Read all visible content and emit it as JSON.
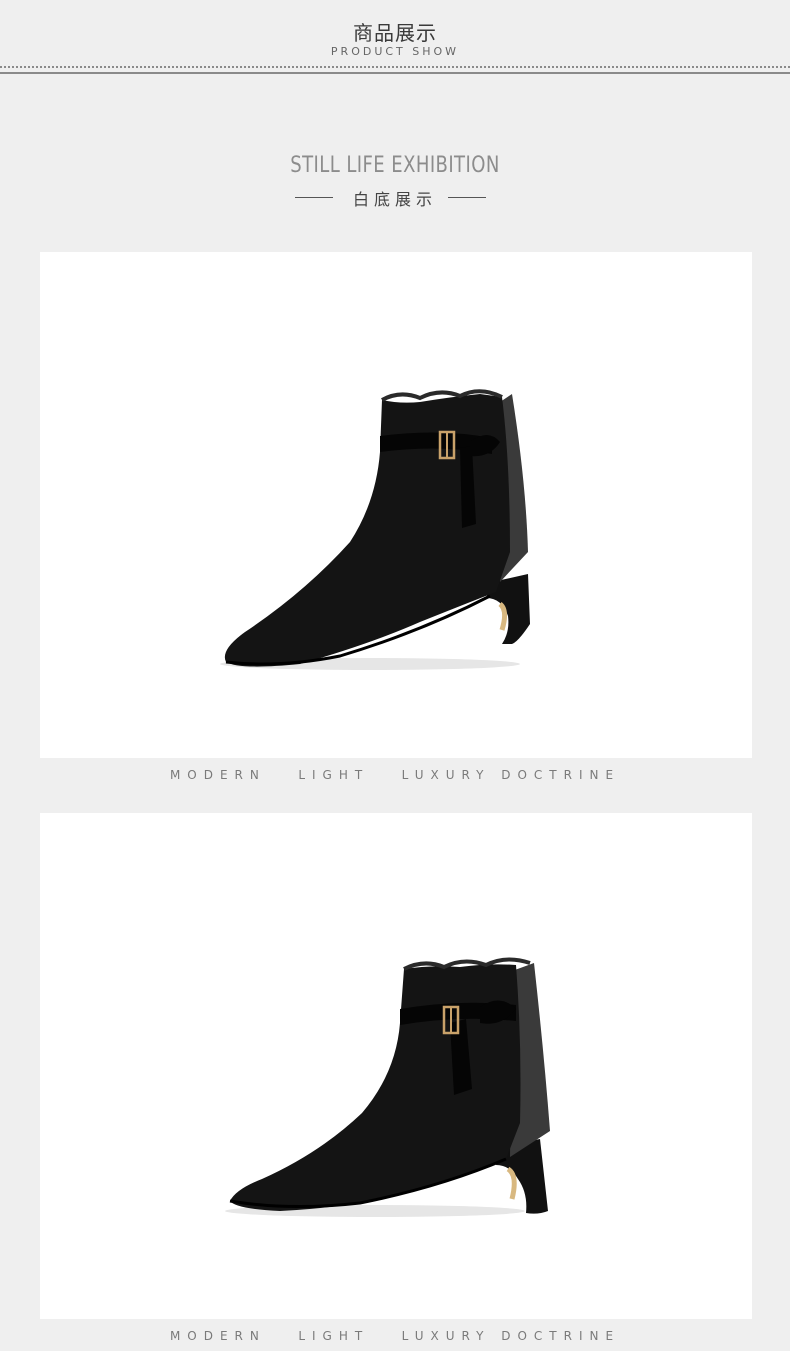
{
  "header": {
    "title_cn": "商品展示",
    "title_en": "PRODUCT SHOW"
  },
  "section": {
    "title": "STILL LIFE  EXHIBITION",
    "subtitle": "白底展示"
  },
  "photos": [
    {
      "caption": "MODERN   LIGHT   LUXURY DOCTRINE"
    },
    {
      "caption": "MODERN   LIGHT   LUXURY DOCTRINE"
    }
  ],
  "colors": {
    "page_bg": "#efefef",
    "photo_bg": "#ffffff",
    "boot": "#141414",
    "hardware": "#c9a26a"
  }
}
